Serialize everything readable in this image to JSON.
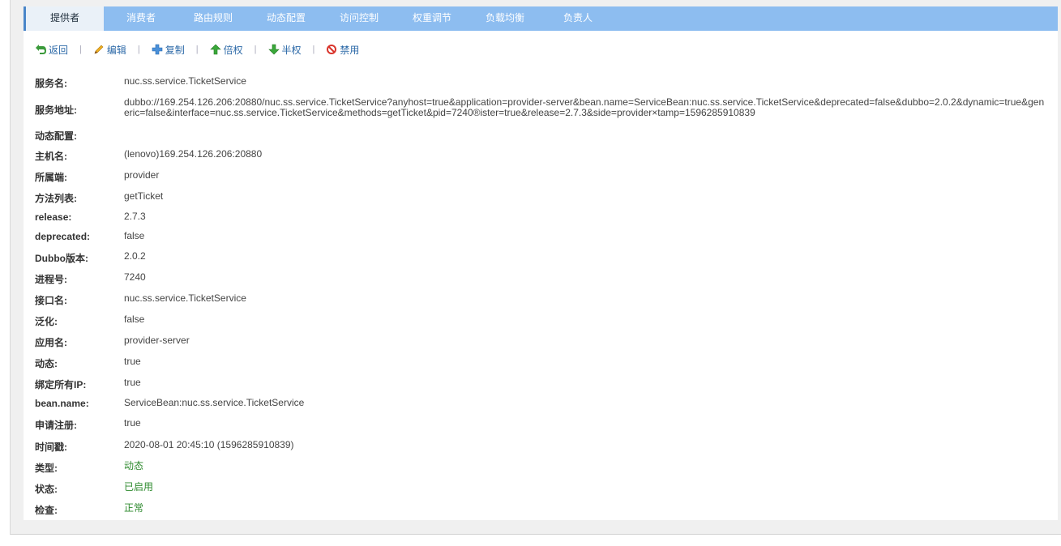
{
  "tabs": [
    {
      "label": "提供者",
      "active": true
    },
    {
      "label": "消费者",
      "active": false
    },
    {
      "label": "路由规则",
      "active": false
    },
    {
      "label": "动态配置",
      "active": false
    },
    {
      "label": "访问控制",
      "active": false
    },
    {
      "label": "权重调节",
      "active": false
    },
    {
      "label": "负载均衡",
      "active": false
    },
    {
      "label": "负责人",
      "active": false
    }
  ],
  "toolbar": {
    "back": "返回",
    "edit": "编辑",
    "copy": "复制",
    "double": "倍权",
    "half": "半权",
    "disable": "禁用",
    "separator": "|"
  },
  "details": [
    {
      "label": "服务名:",
      "value": "nuc.ss.service.TicketService"
    },
    {
      "label": "服务地址:",
      "value": "dubbo://169.254.126.206:20880/nuc.ss.service.TicketService?anyhost=true&application=provider-server&bean.name=ServiceBean:nuc.ss.service.TicketService&deprecated=false&dubbo=2.0.2&dynamic=true&generic=false&interface=nuc.ss.service.TicketService&methods=getTicket&pid=7240®ister=true&release=2.7.3&side=provider×tamp=1596285910839"
    },
    {
      "label": "动态配置:",
      "value": ""
    },
    {
      "label": "主机名:",
      "value": "(lenovo)169.254.126.206:20880"
    },
    {
      "label": "所属端:",
      "value": "provider"
    },
    {
      "label": "方法列表:",
      "value": "getTicket"
    },
    {
      "label": "release:",
      "value": "2.7.3"
    },
    {
      "label": "deprecated:",
      "value": "false"
    },
    {
      "label": "Dubbo版本:",
      "value": "2.0.2"
    },
    {
      "label": "进程号:",
      "value": "7240"
    },
    {
      "label": "接口名:",
      "value": "nuc.ss.service.TicketService"
    },
    {
      "label": "泛化:",
      "value": "false"
    },
    {
      "label": "应用名:",
      "value": "provider-server"
    },
    {
      "label": "动态:",
      "value": "true"
    },
    {
      "label": "绑定所有IP:",
      "value": "true"
    },
    {
      "label": "bean.name:",
      "value": "ServiceBean:nuc.ss.service.TicketService"
    },
    {
      "label": "申请注册:",
      "value": "true"
    },
    {
      "label": "时间戳:",
      "value": "2020-08-01 20:45:10 (1596285910839)"
    },
    {
      "label": "类型:",
      "value": "动态"
    },
    {
      "label": "状态:",
      "value": "已启用"
    },
    {
      "label": "检查:",
      "value": "正常"
    }
  ],
  "colors": {
    "tabbar": "#8dbdf0",
    "link": "#2d6aa8",
    "status_green": "#2e8a2e"
  }
}
